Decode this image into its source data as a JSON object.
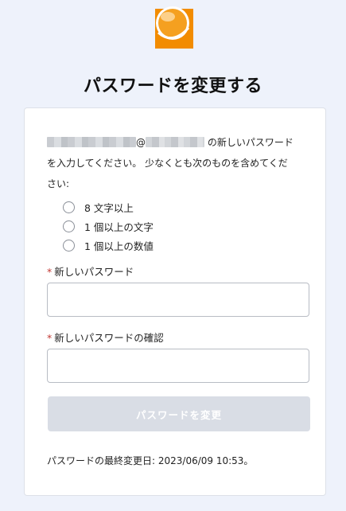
{
  "brand": {
    "logo_icon": "orange-sphere-logo-icon",
    "accent": "#f28c00"
  },
  "page": {
    "title": "パスワードを変更する"
  },
  "instructions": {
    "at_sign": "@",
    "line1_tail": "の新しいパスワード",
    "line2": "を入力してください。 少なくとも次のものを含めてくだ",
    "line3": "さい:"
  },
  "requirements": [
    {
      "label": "8 文字以上",
      "icon": "unchecked-circle-icon"
    },
    {
      "label": "1 個以上の文字",
      "icon": "unchecked-circle-icon"
    },
    {
      "label": "1 個以上の数値",
      "icon": "unchecked-circle-icon"
    }
  ],
  "form": {
    "required_marker": "*",
    "new_password_label": "新しいパスワード",
    "new_password_value": "",
    "confirm_password_label": "新しいパスワードの確認",
    "confirm_password_value": "",
    "submit_label": "パスワードを変更"
  },
  "footer": {
    "last_changed": "パスワードの最終変更日: 2023/06/09 10:53。"
  }
}
